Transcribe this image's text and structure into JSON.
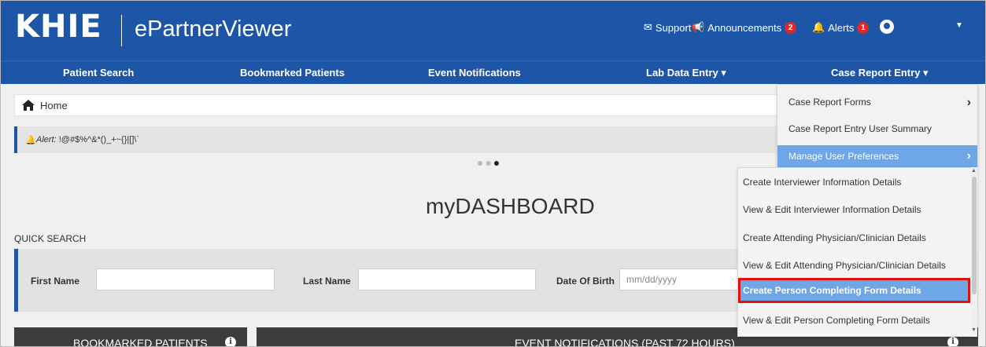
{
  "header": {
    "logo": "KHIE",
    "app_title": "ePartnerViewer",
    "support": "Support",
    "announcements": "Announcements",
    "announcements_count": "2",
    "alerts": "Alerts",
    "alerts_count": "1"
  },
  "nav": {
    "items": [
      "Patient Search",
      "Bookmarked Patients",
      "Event Notifications",
      "Lab Data Entry",
      "Case Report Entry"
    ]
  },
  "breadcrumb": {
    "home": "Home"
  },
  "alert": {
    "label": "Alert:",
    "text": "!@#$%^&*()_+~{}|[]\\`"
  },
  "dashboard": {
    "title": "myDASHBOARD"
  },
  "quick_search": {
    "label": "QUICK SEARCH",
    "first_name": "First Name",
    "last_name": "Last Name",
    "dob": "Date Of Birth",
    "dob_placeholder": "mm/dd/yyyy"
  },
  "panels": {
    "bookmarked": "BOOKMARKED PATIENTS",
    "events": "EVENT NOTIFICATIONS (PAST 72 HOURS)"
  },
  "case_menu": {
    "items": [
      "Case Report Forms",
      "Case Report Entry User Summary",
      "Manage User Preferences"
    ]
  },
  "prefs_menu": {
    "items": [
      "Create Interviewer Information Details",
      "View & Edit Interviewer Information Details",
      "Create Attending Physician/Clinician Details",
      "View & Edit Attending Physician/Clinician Details",
      "Create Person Completing Form Details",
      "View & Edit Person Completing Form Details"
    ]
  },
  "colors": {
    "brand": "#1d56a6",
    "active": "#6ea6e6",
    "highlight": "#e01010"
  }
}
